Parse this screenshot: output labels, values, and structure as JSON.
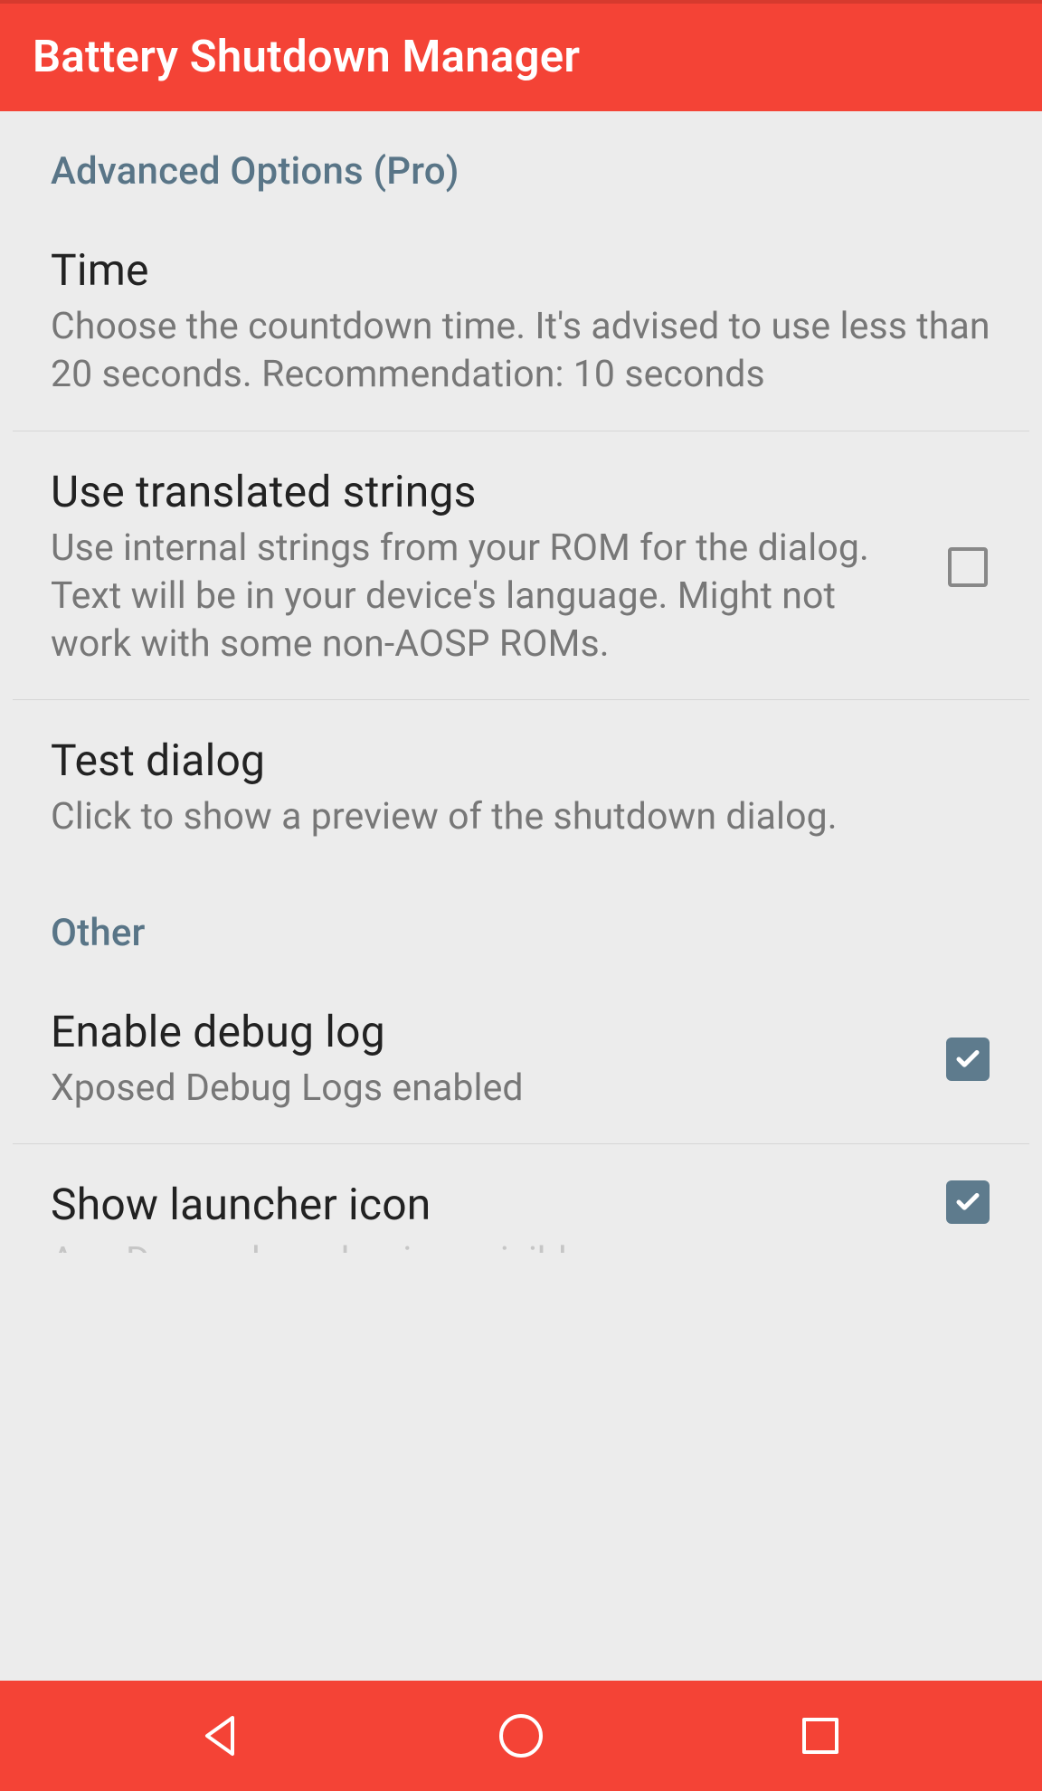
{
  "app": {
    "title": "Battery Shutdown Manager"
  },
  "sections": {
    "advanced": {
      "header": "Advanced Options (Pro)",
      "time": {
        "title": "Time",
        "summary": "Choose the countdown time. It's advised to use less than 20 seconds. Recommendation: 10 seconds"
      },
      "translated": {
        "title": "Use translated strings",
        "summary": "Use internal strings from your ROM for the dialog. Text will be in your device's language. Might not work with some non-AOSP ROMs.",
        "checked": false
      },
      "test": {
        "title": "Test dialog",
        "summary": "Click to show a preview of the shutdown dialog."
      }
    },
    "other": {
      "header": "Other",
      "debug": {
        "title": "Enable debug log",
        "summary": "Xposed Debug Logs enabled",
        "checked": true
      },
      "launcher": {
        "title": "Show launcher icon",
        "summary": "App Drawer launcher icon visible",
        "checked": true
      }
    }
  }
}
